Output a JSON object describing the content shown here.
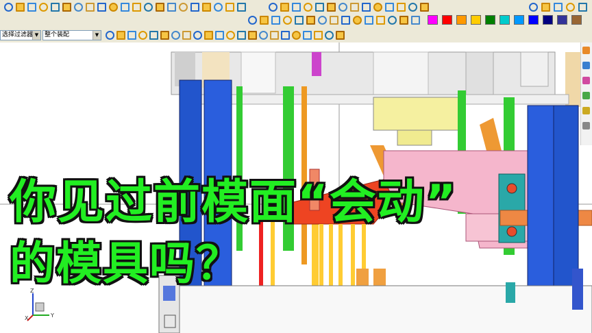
{
  "toolbar": {
    "filter_combo": "选择过滤器",
    "assembly_combo": "整个装配"
  },
  "palette": [
    "#ff00ff",
    "#ff0000",
    "#ff9900",
    "#ffcc00",
    "#008000",
    "#00cccc",
    "#0099ff",
    "#0000ff",
    "#000080",
    "#333399",
    "#996633"
  ],
  "caption": {
    "line1": "你见过前模面“会动”",
    "line2": "的模具吗？"
  },
  "axes": {
    "x": "X",
    "y": "Y",
    "z": "Z"
  },
  "icons": [
    "move-icon",
    "mirror-icon",
    "datum-icon",
    "point-icon",
    "sketch-icon",
    "line-icon",
    "arc-icon",
    "fillet-icon",
    "chamfer-icon",
    "trim-icon",
    "measure-icon",
    "layer-icon",
    "snap-icon",
    "view-icon",
    "render-icon",
    "shade-icon",
    "wireframe-icon",
    "zoom-icon"
  ]
}
